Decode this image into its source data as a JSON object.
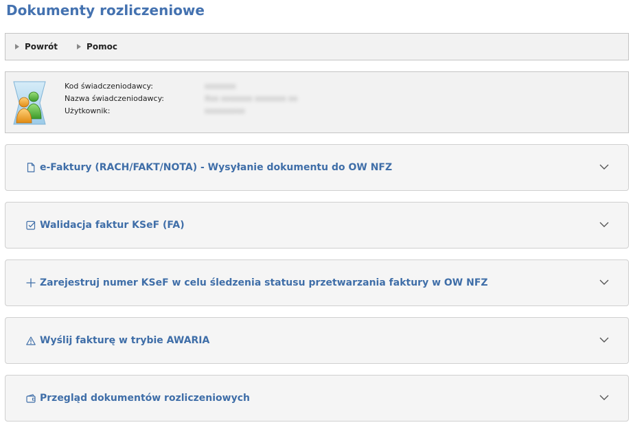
{
  "page": {
    "title": "Dokumenty rozliczeniowe"
  },
  "toolbar": {
    "back_label": "Powrót",
    "help_label": "Pomoc"
  },
  "info": {
    "labels": [
      "Kod świadczeniodawcy:",
      "Nazwa świadczeniodawcy:",
      "Użytkownik:"
    ],
    "values": [
      "xxxxxxx",
      "Xxx xxxxxxx xxxxxxx xx",
      "xxxxxxxxx"
    ]
  },
  "panels": [
    {
      "title": "e-Faktury (RACH/FAKT/NOTA) - Wysyłanie dokumentu do OW NFZ",
      "icon": "document-icon"
    },
    {
      "title": "Walidacja faktur KSeF (FA)",
      "icon": "checkbox-icon"
    },
    {
      "title": "Zarejestruj numer KSeF w celu śledzenia statusu przetwarzania faktury w OW NFZ",
      "icon": "plus-icon"
    },
    {
      "title": "Wyślij fakturę w trybie AWARIA",
      "icon": "warning-icon"
    },
    {
      "title": "Przegląd dokumentów rozliczeniowych",
      "icon": "wallet-icon"
    }
  ],
  "colors": {
    "accent": "#4472b0",
    "panel_title": "#3f6ea8",
    "panel_bg": "#f5f5f5",
    "border": "#c4c4c4"
  }
}
